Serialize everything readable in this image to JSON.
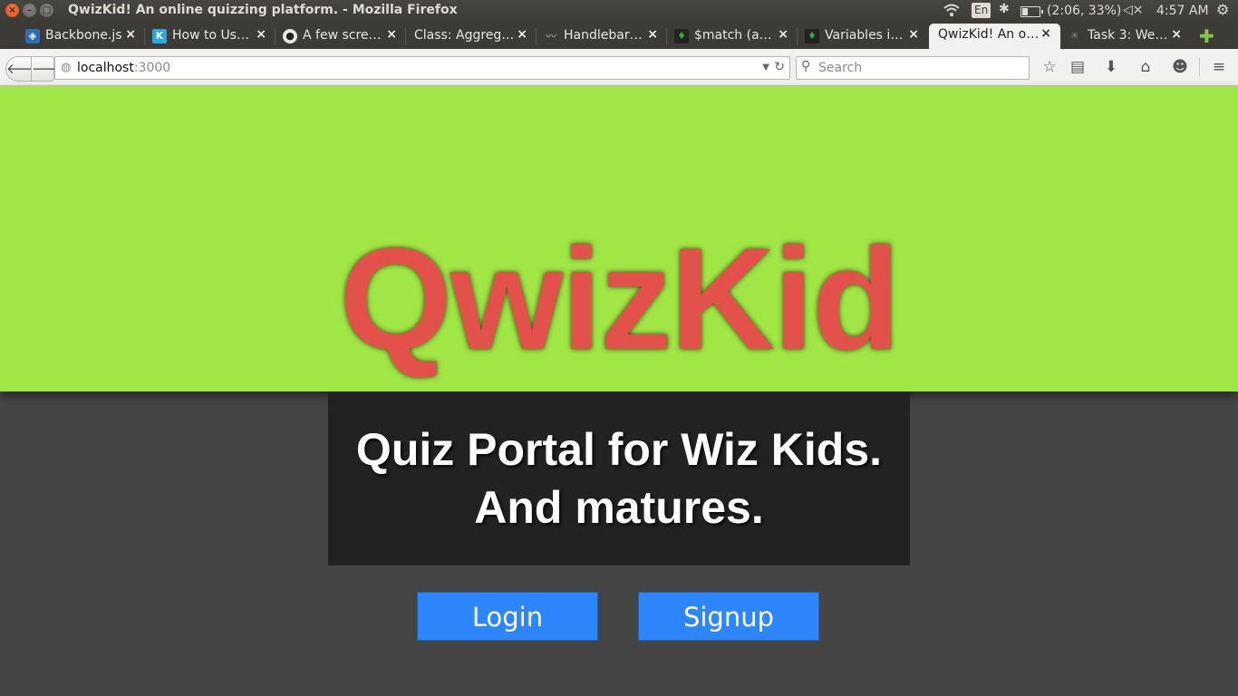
{
  "window": {
    "title": "QwizKid! An online quizzing platform. - Mozilla Firefox",
    "tray": {
      "keyboard": "En",
      "battery": "(2:06, 33%)",
      "clock": "4:57 AM"
    }
  },
  "tabs": [
    {
      "title": "Backbone.js",
      "favicon": "backbone-icon",
      "color": "#2f6db3"
    },
    {
      "title": "How to Us…",
      "favicon": "k-icon",
      "color": "#29a8e0"
    },
    {
      "title": "A few scre…",
      "favicon": "github-icon",
      "color": "#222222"
    },
    {
      "title": "Class: Aggreg…",
      "favicon": "",
      "color": ""
    },
    {
      "title": "Handlebar…",
      "favicon": "mustache-icon",
      "color": "#999999"
    },
    {
      "title": "$match (a…",
      "favicon": "mongodb-leaf-icon",
      "color": "#3fa037"
    },
    {
      "title": "Variables i…",
      "favicon": "mongodb-leaf-icon",
      "color": "#3fa037"
    },
    {
      "title": "QwizKid! An o…",
      "favicon": "",
      "color": "",
      "active": true
    },
    {
      "title": "Task 3: We…",
      "favicon": "spider-icon",
      "color": "#555555"
    }
  ],
  "navbar": {
    "url_host": "localhost",
    "url_port": ":3000",
    "search_placeholder": "Search"
  },
  "page": {
    "logo": "QwizKid",
    "tagline_line1": "Quiz Portal for Wiz Kids.",
    "tagline_line2": "And matures.",
    "login_label": "Login",
    "signup_label": "Signup",
    "colors": {
      "hero": "#a0e644",
      "logo": "#e2524a",
      "button": "#2e86fe",
      "panel": "#222222",
      "background": "#454545"
    }
  }
}
